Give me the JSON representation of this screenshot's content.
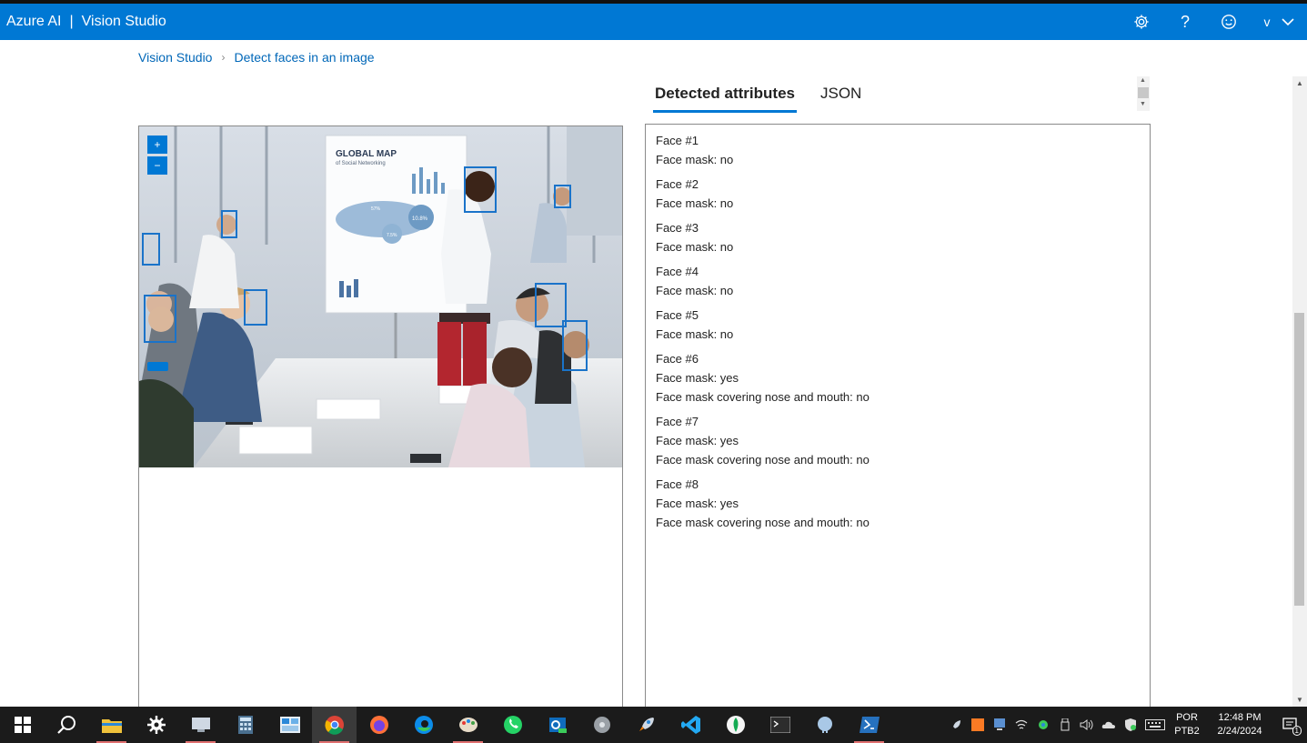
{
  "header": {
    "brand": "Azure AI",
    "separator": "|",
    "product": "Vision Studio",
    "user_initial": "v"
  },
  "breadcrumb": {
    "root": "Vision Studio",
    "current": "Detect faces in an image"
  },
  "tabs": [
    {
      "label": "Detected attributes",
      "active": true
    },
    {
      "label": "JSON",
      "active": false
    }
  ],
  "faces": [
    {
      "title": "Face #1",
      "mask": "Face mask: no"
    },
    {
      "title": "Face #2",
      "mask": "Face mask: no"
    },
    {
      "title": "Face #3",
      "mask": "Face mask: no"
    },
    {
      "title": "Face #4",
      "mask": "Face mask: no"
    },
    {
      "title": "Face #5",
      "mask": "Face mask: no"
    },
    {
      "title": "Face #6",
      "mask": "Face mask: yes",
      "covering": "Face mask covering nose and mouth: no"
    },
    {
      "title": "Face #7",
      "mask": "Face mask: yes",
      "covering": "Face mask covering nose and mouth: no"
    },
    {
      "title": "Face #8",
      "mask": "Face mask: yes",
      "covering": "Face mask covering nose and mouth: no"
    }
  ],
  "image": {
    "chart_title": "GLOBAL MAP",
    "chart_subtitle": "of Social Networking",
    "stat_a": "10.8%",
    "stat_b": "7.5%",
    "stat_c": "57%"
  },
  "zoom": {
    "in": "+",
    "out": "−"
  },
  "taskbar": {
    "language": "POR",
    "layout": "PTB2",
    "time": "12:48 PM",
    "date": "2/24/2024",
    "notifications": "1"
  },
  "colors": {
    "accent": "#0078d4",
    "taskbar": "#1b1b1b"
  }
}
